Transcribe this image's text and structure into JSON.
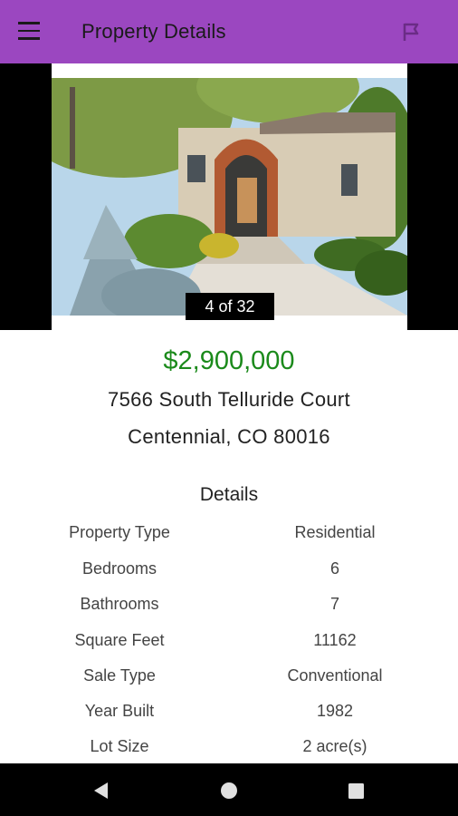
{
  "appbar": {
    "title": "Property Details",
    "menu_icon": "hamburger-menu-icon",
    "action_icon": "flag-icon",
    "color": "#9b47c0"
  },
  "photo": {
    "counter": "4 of 32",
    "current": 4,
    "total": 32
  },
  "listing": {
    "price": "$2,900,000",
    "price_color": "#1b8a1b",
    "address_line1": "7566 South Telluride Court",
    "address_line2": "Centennial, CO 80016"
  },
  "details": {
    "title": "Details",
    "rows": [
      {
        "label": "Property Type",
        "value": "Residential"
      },
      {
        "label": "Bedrooms",
        "value": "6"
      },
      {
        "label": "Bathrooms",
        "value": "7"
      },
      {
        "label": "Square Feet",
        "value": "11162"
      },
      {
        "label": "Sale Type",
        "value": "Conventional"
      },
      {
        "label": "Year Built",
        "value": "1982"
      },
      {
        "label": "Lot Size",
        "value": "2 acre(s)"
      }
    ]
  },
  "navbar": {
    "back_icon": "back-triangle-icon",
    "home_icon": "home-circle-icon",
    "recents_icon": "recents-square-icon"
  }
}
